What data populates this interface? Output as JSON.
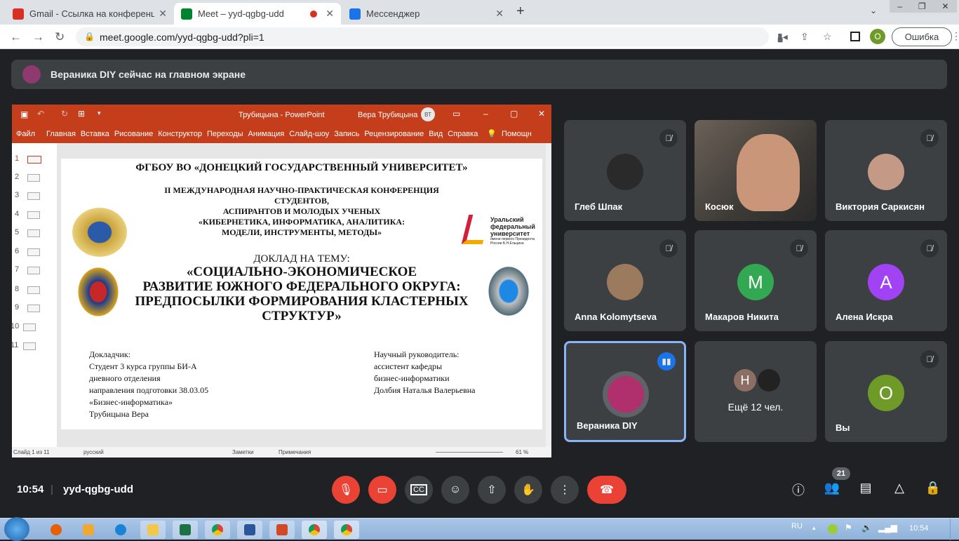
{
  "browser": {
    "tabs": [
      {
        "title": "Gmail - Ссылка на конференци",
        "close": "✕",
        "active": false,
        "color": "#d93025"
      },
      {
        "title": "Meet – yyd-qgbg-udd",
        "close": "✕",
        "active": true,
        "color": "#00832d"
      },
      {
        "title": "Мессенджер",
        "close": "✕",
        "active": false,
        "color": "#1a73e8"
      }
    ],
    "url": "meet.google.com/yyd-qgbg-udd?pli=1",
    "profile_initial": "О",
    "error_label": "Ошибка"
  },
  "banner": {
    "text": "Вераника DIY сейчас на главном экране"
  },
  "ppt": {
    "title": "Трубицына  -  PowerPoint",
    "user": "Вера Трубицына",
    "user_initials": "ВТ",
    "ribbon": [
      "Файл",
      "Главная",
      "Вставка",
      "Рисование",
      "Конструктор",
      "Переходы",
      "Анимация",
      "Слайд-шоу",
      "Запись",
      "Рецензирование",
      "Вид",
      "Справка",
      "Помощн"
    ],
    "thumbs": [
      "1",
      "2",
      "3",
      "4",
      "5",
      "6",
      "7",
      "8",
      "9",
      "10",
      "11"
    ],
    "status": {
      "slide": "Слайд 1 из 11",
      "lang": "русский",
      "notes": "Заметки",
      "comments": "Примечания",
      "zoom": "61 %"
    }
  },
  "slide": {
    "uni": "ФГБОУ ВО «ДОНЕЦКИЙ ГОСУДАРСТВЕННЫЙ УНИВЕРСИТЕТ»",
    "conf1": "II МЕЖДУНАРОДНАЯ НАУЧНО-ПРАКТИЧЕСКАЯ КОНФЕРЕНЦИЯ",
    "conf2": "СТУДЕНТОВ,",
    "conf3": "АСПИРАНТОВ И МОЛОДЫХ УЧЕНЫХ",
    "conf4": "«КИБЕРНЕТИКА, ИНФОРМАТИКА, АНАЛИТИКА:",
    "conf5": "МОДЕЛИ, ИНСТРУМЕНТЫ, МЕТОДЫ»",
    "report": "ДОКЛАД НА ТЕМУ:",
    "topic1": "«СОЦИАЛЬНО-ЭКОНОМИЧЕСКОЕ",
    "topic2": "РАЗВИТИЕ ЮЖНОГО ФЕДЕРАЛЬНОГО ОКРУГА:",
    "topic3": "ПРЕДПОСЫЛКИ ФОРМИРОВАНИЯ КЛАСТЕРНЫХ",
    "topic4": "СТРУКТУР»",
    "urfu1": "Уральский",
    "urfu2": "федеральный",
    "urfu3": "университет",
    "urfu4": "имени первого Президента",
    "urfu5": "России Б.Н.Ельцина",
    "left": [
      "Докладчик:",
      "Студент 3 курса группы БИ-А",
      "дневного отделения",
      "направления подготовки 38.03.05",
      "«Бизнес-информатика»",
      "Трубицына Вера"
    ],
    "right": [
      "Научный руководитель:",
      "ассистент кафедры",
      "бизнес-информатики",
      "Долбия Наталья Валерьевна"
    ]
  },
  "participants": [
    {
      "name": "Глеб Шпак",
      "type": "photo",
      "color": "#2a2a2a"
    },
    {
      "name": "Косюк",
      "type": "video",
      "color": "#5a5248"
    },
    {
      "name": "Виктория Саркисян",
      "type": "photo",
      "color": "#c49a86"
    },
    {
      "name": "Anna Kolomytseva",
      "type": "photo",
      "color": "#9c7a5e"
    },
    {
      "name": "Макаров Никита",
      "type": "letter",
      "letter": "M",
      "color": "#33a852"
    },
    {
      "name": "Алена Искра",
      "type": "letter",
      "letter": "A",
      "color": "#a142f4"
    },
    {
      "name": "Вераника DIY",
      "type": "photo",
      "color": "#b0306e"
    },
    {
      "name": "Ещё 12 чел.",
      "type": "more",
      "letter": "Н",
      "color": "#8d6e63"
    },
    {
      "name": "Вы",
      "type": "letter",
      "letter": "О",
      "color": "#6e9a27"
    }
  ],
  "meeting": {
    "time": "10:54",
    "code": "yyd-qgbg-udd",
    "people_count": "21"
  },
  "taskbar": {
    "lang": "RU",
    "clock": "10:54"
  }
}
